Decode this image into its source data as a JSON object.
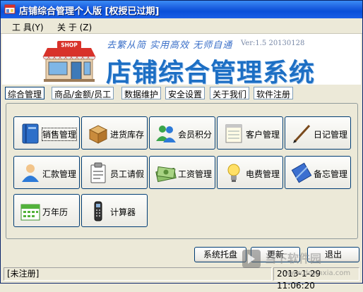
{
  "window": {
    "title": "店铺综合管理个人版 [权授已过期]"
  },
  "menu": [
    {
      "label": "工 具(Y)"
    },
    {
      "label": "关 于 (Z)"
    }
  ],
  "banner": {
    "slogan": "去繁从简 实用高效 无师自通",
    "version": "Ver:1.5 20130128",
    "title": "店铺综合管理系统",
    "logo_text": "SHOP"
  },
  "tabs": [
    {
      "label": "综合管理",
      "active": true
    },
    {
      "label": "商品/金额/员工"
    },
    {
      "label": "数据维护"
    },
    {
      "label": "安全设置"
    },
    {
      "label": "关于我们"
    },
    {
      "label": "软件注册"
    }
  ],
  "tiles": [
    {
      "label": "销售管理",
      "icon": "book-icon"
    },
    {
      "label": "进货库存",
      "icon": "box-icon"
    },
    {
      "label": "会员积分",
      "icon": "people-icon"
    },
    {
      "label": "客户管理",
      "icon": "notepad-icon"
    },
    {
      "label": "日记管理",
      "icon": "pen-icon"
    },
    {
      "label": "汇款管理",
      "icon": "user-icon"
    },
    {
      "label": "员工请假",
      "icon": "clipboard-icon"
    },
    {
      "label": "工资管理",
      "icon": "money-icon"
    },
    {
      "label": "电费管理",
      "icon": "bulb-icon"
    },
    {
      "label": "备忘管理",
      "icon": "notebook-icon"
    },
    {
      "label": "万年历",
      "icon": "calendar-icon"
    },
    {
      "label": "计算器",
      "icon": "phone-icon"
    }
  ],
  "buttons": {
    "tray": "系统托盘",
    "update": "更新",
    "exit": "退出"
  },
  "status": {
    "registration": "[未注册]",
    "datetime": "2013-1-29  11:06:20"
  },
  "watermark": {
    "text": "当下软件园",
    "url": "www.downxia.com"
  },
  "colors": {
    "titlebar": "#0a4fd8",
    "banner_title": "#1d6fc4",
    "slogan": "#3a6fc8"
  }
}
